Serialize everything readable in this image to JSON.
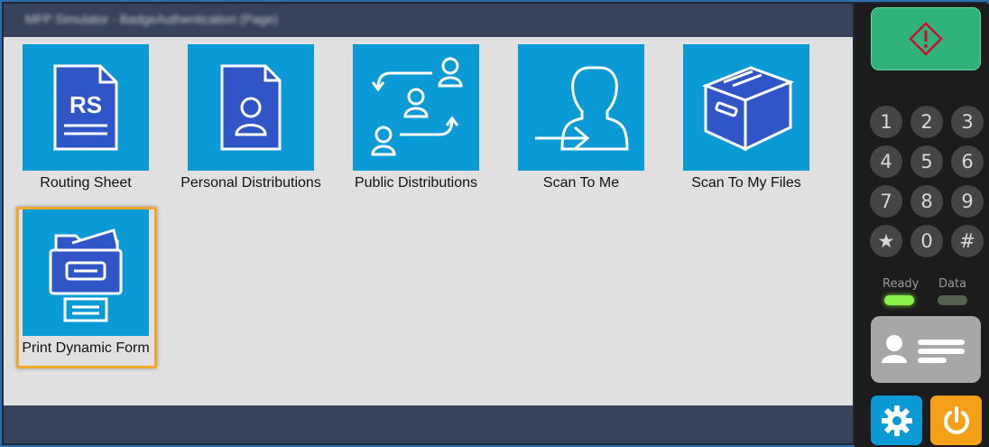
{
  "titlebar": {
    "title": "MFP Simulator - BadgeAuthentication (Page)"
  },
  "tiles": [
    {
      "label": "Routing Sheet",
      "icon": "routing-sheet-icon",
      "icon_text": "RS"
    },
    {
      "label": "Personal Distributions",
      "icon": "personal-distribution-icon"
    },
    {
      "label": "Public Distributions",
      "icon": "public-distribution-icon"
    },
    {
      "label": "Scan To Me",
      "icon": "scan-to-me-icon"
    },
    {
      "label": "Scan To My Files",
      "icon": "file-box-icon"
    },
    {
      "label": "Print Dynamic Form",
      "icon": "print-form-icon",
      "selected": true
    }
  ],
  "keypad": {
    "keys": [
      "1",
      "2",
      "3",
      "4",
      "5",
      "6",
      "7",
      "8",
      "9",
      "★",
      "0",
      "#"
    ]
  },
  "status": {
    "ready_label": "Ready",
    "data_label": "Data",
    "ready_on": true,
    "data_on": false
  },
  "colors": {
    "tile": "#0a9ad6",
    "start": "#2fb37a",
    "selection": "#f0a828",
    "power": "#f4a019"
  }
}
